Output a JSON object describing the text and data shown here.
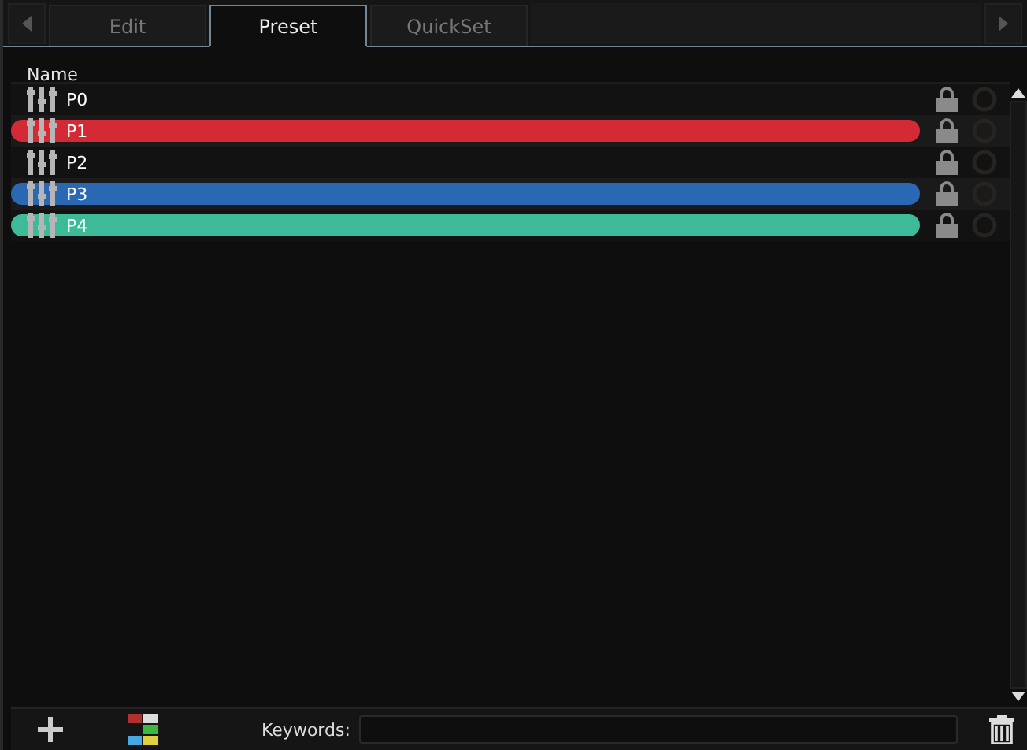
{
  "tabs": [
    {
      "label": "Edit",
      "selected": false
    },
    {
      "label": "Preset",
      "selected": true
    },
    {
      "label": "QuickSet",
      "selected": false
    }
  ],
  "table": {
    "columns": [
      "Name"
    ],
    "rows": [
      {
        "name": "P0",
        "color": null
      },
      {
        "name": "P1",
        "color": "#d42a35"
      },
      {
        "name": "P2",
        "color": null
      },
      {
        "name": "P3",
        "color": "#2a68b4"
      },
      {
        "name": "P4",
        "color": "#3dbb99"
      }
    ]
  },
  "footer": {
    "keywords_label": "Keywords:"
  }
}
